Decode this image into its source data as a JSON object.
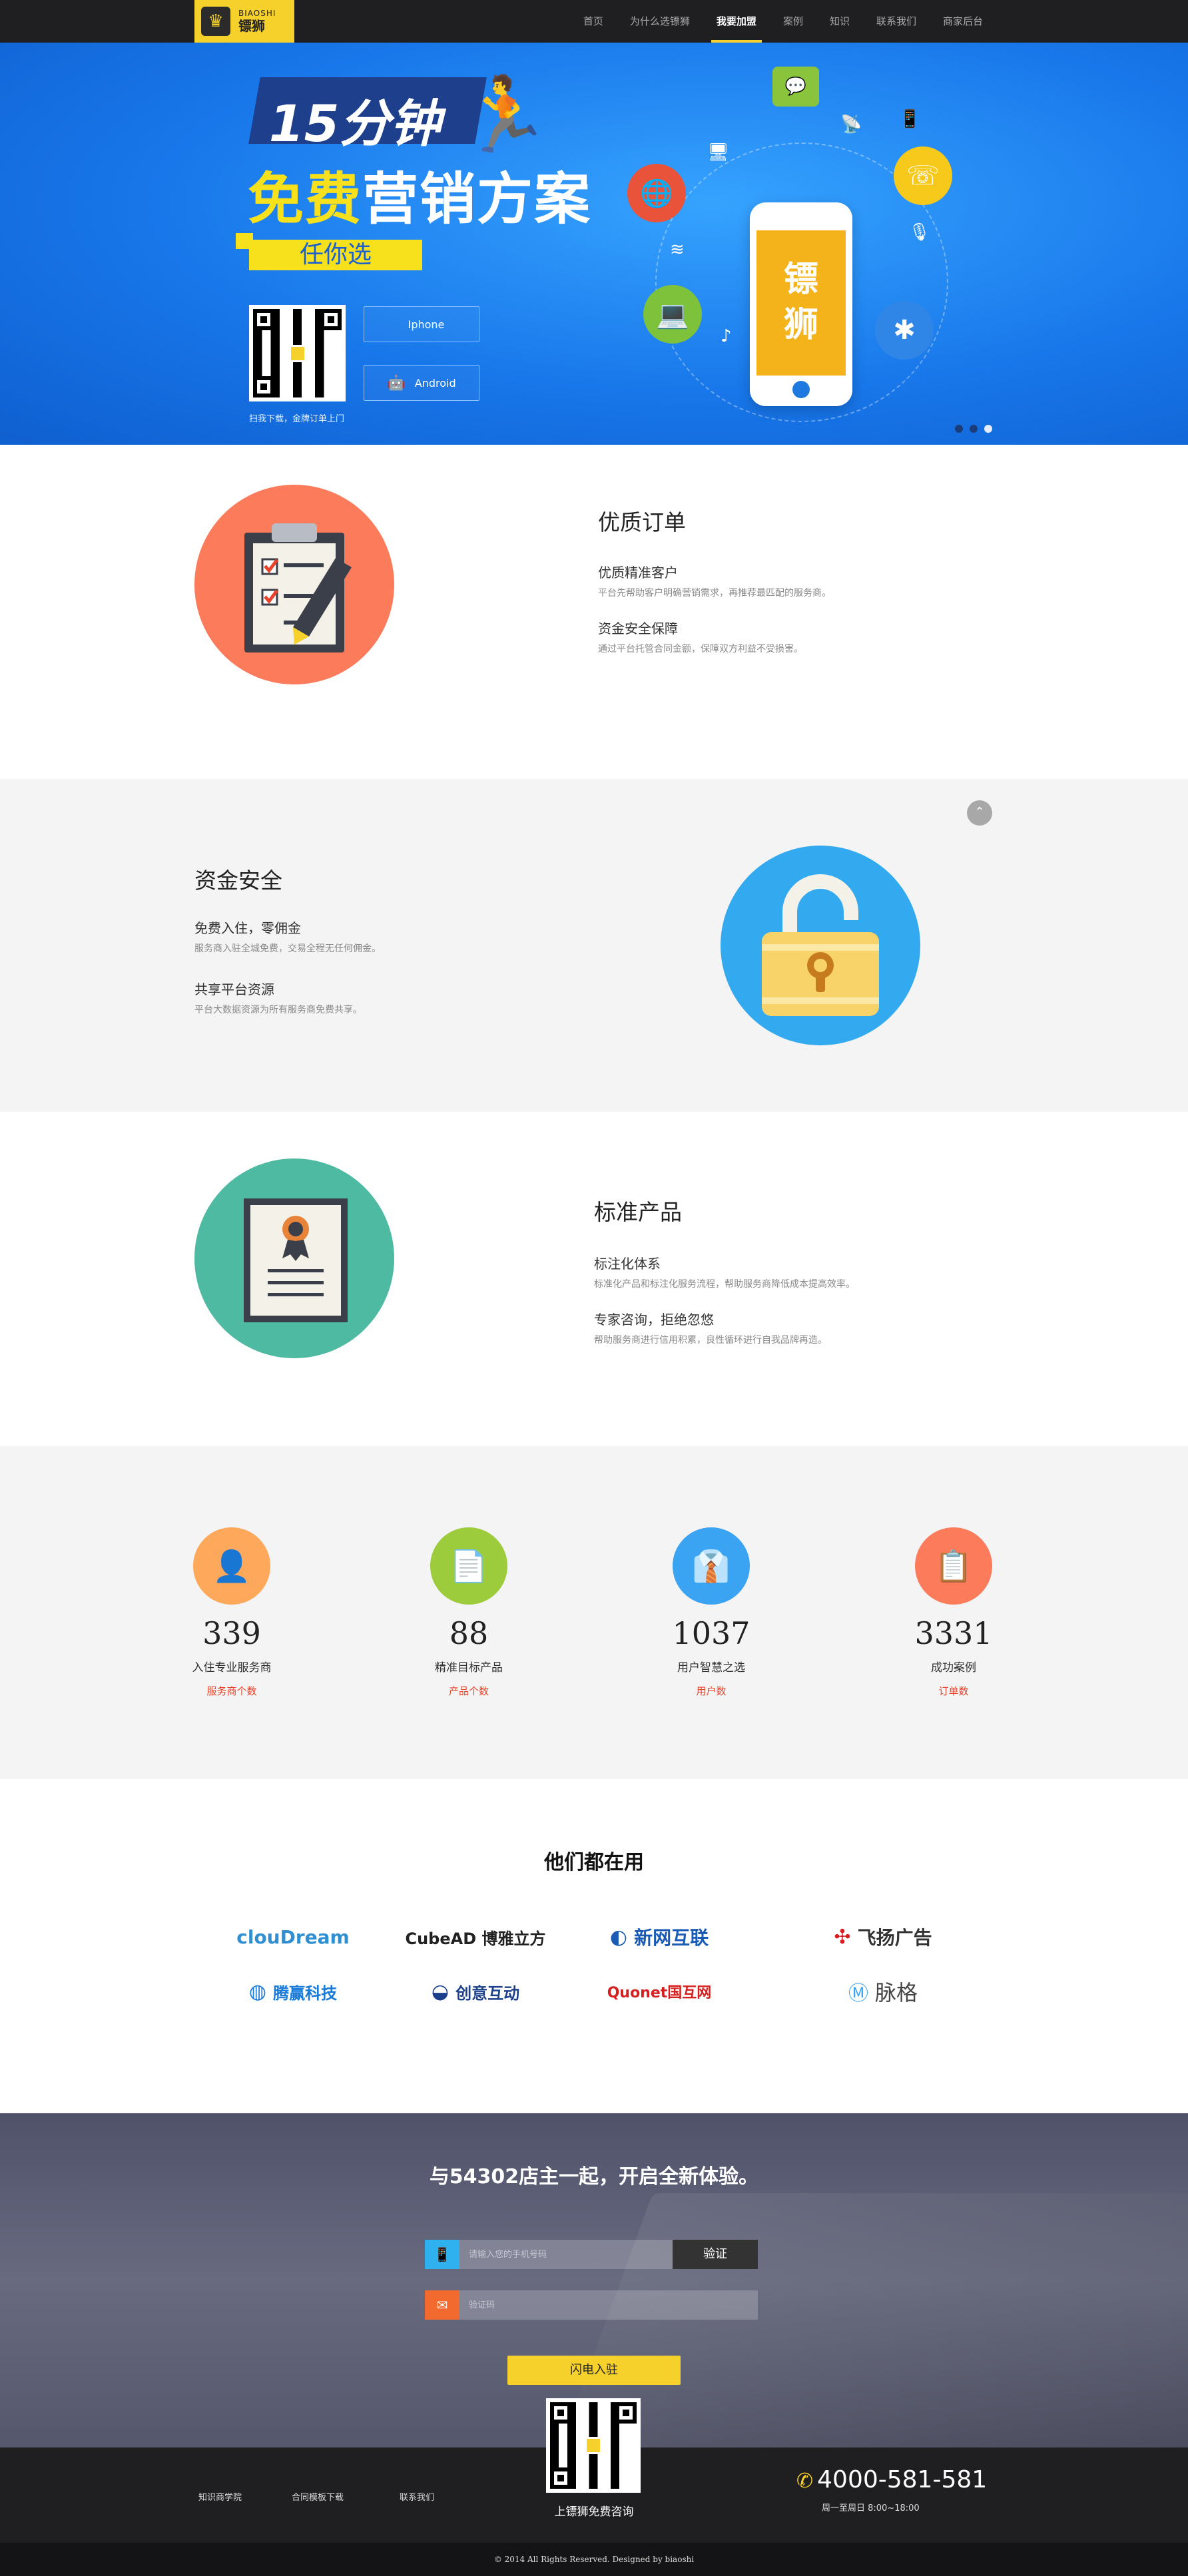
{
  "nav": {
    "logo_en": "BIAOSHI",
    "logo_cn": "镖狮",
    "items": [
      "首页",
      "为什么选镖狮",
      "我要加盟",
      "案例",
      "知识",
      "联系我们",
      "商家后台"
    ],
    "active_index": 2
  },
  "hero": {
    "headline_1": "15分钟",
    "headline_2a": "免费",
    "headline_2b": "营销方案",
    "tagline": "任你选",
    "iphone_label": "Iphone",
    "android_label": "Android",
    "caption": "扫我下载，金牌订单上门",
    "phone_text_1": "镖",
    "phone_text_2": "狮",
    "slides": 3,
    "active_slide": 2
  },
  "features": [
    {
      "title": "优质订单",
      "items": [
        {
          "name": "优质精准客户",
          "desc": "平台先帮助客户明确营销需求，再推荐最匹配的服务商。"
        },
        {
          "name": "资金安全保障",
          "desc": "通过平台托管合同金额，保障双方利益不受损害。"
        }
      ],
      "color": "#fb7b5b"
    },
    {
      "title": "资金安全",
      "items": [
        {
          "name": "免费入住，零佣金",
          "desc": "服务商入驻全城免费，交易全程无任何佣金。"
        },
        {
          "name": "共享平台资源",
          "desc": "平台大数据资源为所有服务商免费共享。"
        }
      ],
      "color": "#33aaf0"
    },
    {
      "title": "标准产品",
      "items": [
        {
          "name": "标注化体系",
          "desc": "标准化产品和标注化服务流程，帮助服务商降低成本提高效率。"
        },
        {
          "name": "专家咨询，拒绝忽悠",
          "desc": "帮助服务商进行信用积累，良性循环进行自我品牌再造。"
        }
      ],
      "color": "#4fbaa2"
    }
  ],
  "stats": [
    {
      "num": "339",
      "label": "入住专业服务商",
      "tag": "服务商个数",
      "color": "#fda85b",
      "icon": "person-icon"
    },
    {
      "num": "88",
      "label": "精准目标产品",
      "tag": "产品个数",
      "color": "#9ccb3c",
      "icon": "document-icon"
    },
    {
      "num": "1037",
      "label": "用户智慧之选",
      "tag": "用户数",
      "color": "#3aa3f2",
      "icon": "user-tie-icon"
    },
    {
      "num": "3331",
      "label": "成功案例",
      "tag": "订单数",
      "color": "#fb7b5b",
      "icon": "notes-icon"
    }
  ],
  "partners": {
    "title": "他们都在用",
    "logos": [
      {
        "text": "clouDream",
        "color": "#2f8fd0"
      },
      {
        "text": "CubeAD 博雅立方",
        "color": "#222"
      },
      {
        "text": "新网互联",
        "color": "#1a5bb5"
      },
      {
        "text": "飞扬广告",
        "color": "#333"
      },
      {
        "text": "腾赢科技",
        "color": "#1a7ad8"
      },
      {
        "text": "创意互动",
        "color": "#1b3f8a"
      },
      {
        "text": "Quonet国互网",
        "color": "#d62020"
      },
      {
        "text": "脉格",
        "color": "#444"
      }
    ]
  },
  "cta": {
    "title": "与54302店主一起，开启全新体验。",
    "phone_placeholder": "请输入您的手机号码",
    "code_placeholder": "验证码",
    "verify_label": "验证",
    "join_label": "闪电入驻"
  },
  "footer": {
    "links": [
      "知识商学院",
      "合同模板下载",
      "联系我们"
    ],
    "qr_caption": "上镖狮免费咨询",
    "phone": "4000-581-581",
    "hours": "周一至周日 8:00~18:00",
    "copyright": "© 2014 All Rights Reserved. Designed by biaoshi"
  },
  "colors": {
    "accent": "#f6d12c",
    "hero_blue": "#1877ea",
    "nav_bg": "#1f1f22"
  }
}
